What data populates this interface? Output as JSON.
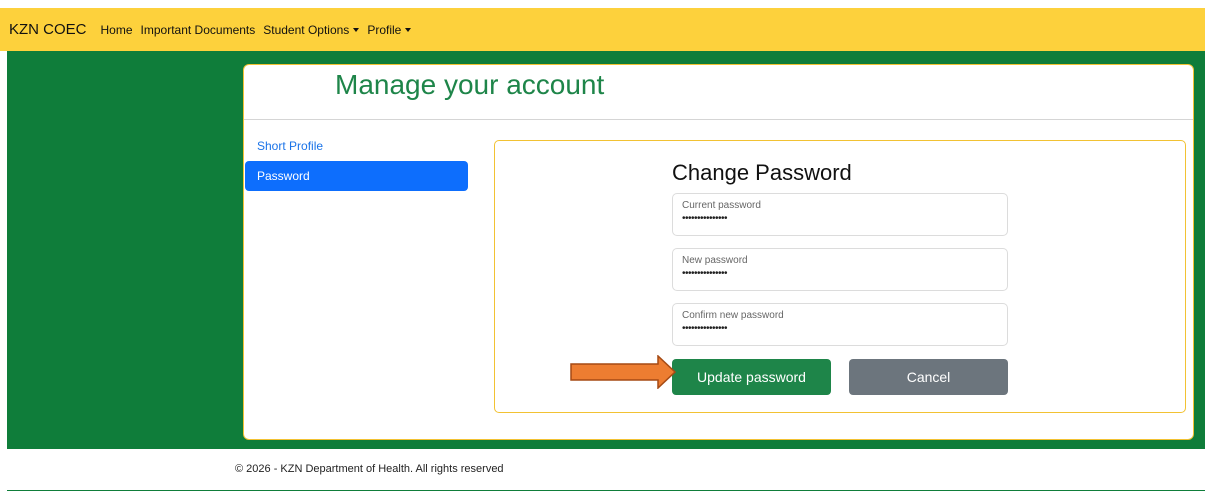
{
  "navbar": {
    "brand": "KZN COEC",
    "links": [
      {
        "label": "Home"
      },
      {
        "label": "Important Documents"
      },
      {
        "label": "Student Options"
      },
      {
        "label": "Profile"
      }
    ]
  },
  "page": {
    "title": "Manage your account"
  },
  "sidebar": {
    "items": [
      {
        "label": "Short Profile"
      },
      {
        "label": "Password"
      }
    ]
  },
  "change_password": {
    "title": "Change Password",
    "current_label": "Current password",
    "current_value": "•••••••••••••••",
    "new_label": "New password",
    "new_value": "•••••••••••••••",
    "confirm_label": "Confirm new password",
    "confirm_value": "•••••••••••••••",
    "update_button": "Update password",
    "cancel_button": "Cancel"
  },
  "footer": {
    "text": "© 2026 - KZN Department of Health. All rights reserved"
  },
  "colors": {
    "navbar_bg": "#fdd13c",
    "green": "#0f7d3a",
    "accent_green": "#1e8549",
    "active_blue": "#0d6efd",
    "cancel_gray": "#6c757d",
    "arrow_orange": "#ed7d31"
  }
}
